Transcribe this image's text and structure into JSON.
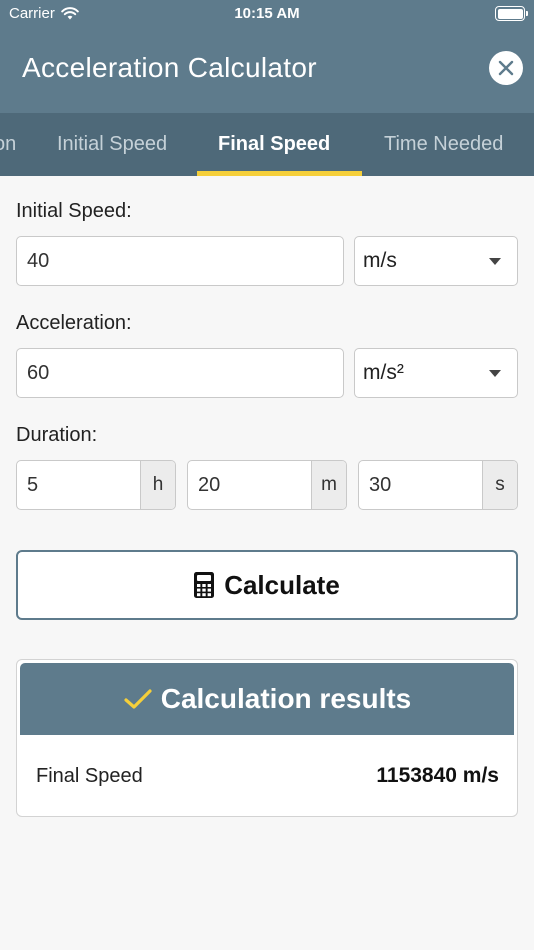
{
  "status_bar": {
    "carrier": "Carrier",
    "time": "10:15 AM"
  },
  "header": {
    "title": "Acceleration Calculator"
  },
  "tabs": [
    {
      "label": "on",
      "active": false
    },
    {
      "label": "Initial Speed",
      "active": false
    },
    {
      "label": "Final Speed",
      "active": true
    },
    {
      "label": "Time Needed",
      "active": false
    }
  ],
  "form": {
    "initial_speed": {
      "label": "Initial Speed:",
      "value": "40",
      "unit": "m/s"
    },
    "acceleration": {
      "label": "Acceleration:",
      "value": "60",
      "unit": "m/s²"
    },
    "duration": {
      "label": "Duration:",
      "hours": "5",
      "hours_unit": "h",
      "minutes": "20",
      "minutes_unit": "m",
      "seconds": "30",
      "seconds_unit": "s"
    }
  },
  "calculate_button": {
    "label": "Calculate",
    "icon": "calculator-icon"
  },
  "results": {
    "title": "Calculation results",
    "icon": "checkmark-icon",
    "rows": [
      {
        "label": "Final Speed",
        "value": "1153840 m/s"
      }
    ]
  },
  "colors": {
    "header": "#5e7b8c",
    "tab_bar": "#4e6979",
    "accent": "#f5cf3a",
    "background": "#f7f7f7"
  }
}
